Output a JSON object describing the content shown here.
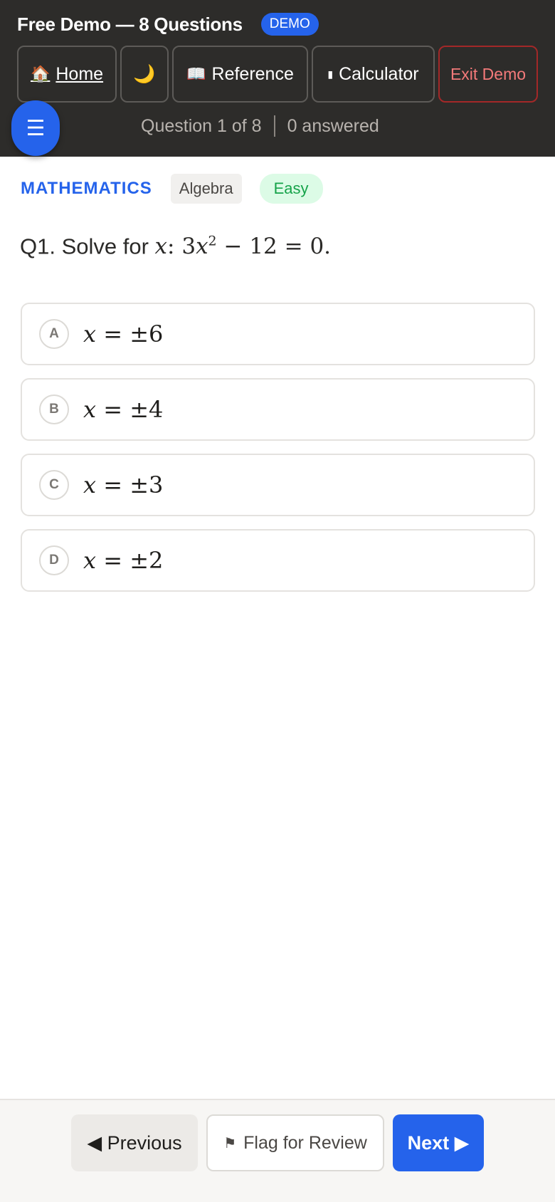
{
  "header": {
    "title": "Free Demo — 8 Questions",
    "badge": "DEMO",
    "toolbar": {
      "home_icon": "🏠",
      "home_label": "Home",
      "theme_icon": "🌙",
      "reference_icon": "📖",
      "reference_label": "Reference",
      "calculator_icon": "▮",
      "calculator_label": "Calculator",
      "exit_label": "Exit Demo"
    },
    "menu_icon": "☰",
    "progress": {
      "question_position": "Question 1 of 8",
      "answered": "0 answered"
    }
  },
  "question": {
    "subject": "MATHEMATICS",
    "topic": "Algebra",
    "difficulty": "Easy",
    "prefix": "Q1. Solve for ",
    "variable": "x",
    "equation_coef": "3",
    "equation_var": "x",
    "equation_exp": "2",
    "equation_rest": " − 12 = 0.",
    "options": [
      {
        "letter": "A",
        "var": "x",
        "value": " = ±6"
      },
      {
        "letter": "B",
        "var": "x",
        "value": " = ±4"
      },
      {
        "letter": "C",
        "var": "x",
        "value": " = ±3"
      },
      {
        "letter": "D",
        "var": "x",
        "value": " = ±2"
      }
    ]
  },
  "footer": {
    "previous_label": "◀ Previous",
    "flag_icon": "⚑",
    "flag_label": "Flag for Review",
    "next_label": "Next ▶"
  },
  "colors": {
    "accent": "#2563eb",
    "header_bg": "#2d2c2a",
    "exit_red": "#f47a7a",
    "easy_green": "#16a34a"
  }
}
